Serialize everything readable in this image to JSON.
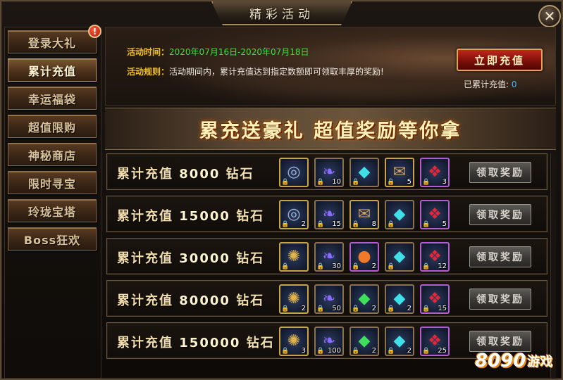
{
  "window": {
    "title": "精彩活动",
    "close_label": "✕"
  },
  "sidebar": {
    "alert": "!",
    "items": [
      {
        "label": "登录大礼",
        "active": false
      },
      {
        "label": "累计充值",
        "active": true
      },
      {
        "label": "幸运福袋",
        "active": false
      },
      {
        "label": "超值限购",
        "active": false
      },
      {
        "label": "神秘商店",
        "active": false
      },
      {
        "label": "限时寻宝",
        "active": false
      },
      {
        "label": "玲珑宝塔",
        "active": false
      },
      {
        "label": "Boss狂欢",
        "active": false
      }
    ]
  },
  "header": {
    "time_label": "活动时间：",
    "time_value": "2020年07月16日-2020年07月18日",
    "rule_label": "活动规则：",
    "rule_value": "活动期间内，累计充值达到指定数额即可领取丰厚的奖励!",
    "recharge_button": "立即充值",
    "accum_label": "已累计充值: ",
    "accum_value": "0"
  },
  "slogan": "累充送豪礼  超值奖励等你拿",
  "rows": [
    {
      "prefix": "累计充值",
      "amount": "8000",
      "unit": "钻石",
      "items": [
        {
          "icon": "compass-token-icon",
          "glyph": "◎",
          "count": "",
          "color": "#9fb6d8",
          "frame": "gold"
        },
        {
          "icon": "feather-icon",
          "glyph": "❧",
          "count": "10",
          "color": "#8a6cff",
          "frame": "normal"
        },
        {
          "icon": "cyan-crystal-icon",
          "glyph": "◆",
          "count": "",
          "color": "#3fe0e8",
          "frame": "normal"
        },
        {
          "icon": "scroll-bag-icon",
          "glyph": "✉",
          "count": "5",
          "color": "#d2a05a",
          "frame": "gold"
        },
        {
          "icon": "red-gem-icon",
          "glyph": "❖",
          "count": "3",
          "color": "#e0283a",
          "frame": "purple"
        }
      ],
      "claim": "领取奖励"
    },
    {
      "prefix": "累计充值",
      "amount": "15000",
      "unit": "钻石",
      "items": [
        {
          "icon": "compass-token-icon",
          "glyph": "◎",
          "count": "2",
          "color": "#9fb6d8",
          "frame": "gold"
        },
        {
          "icon": "feather-icon",
          "glyph": "❧",
          "count": "15",
          "color": "#8a6cff",
          "frame": "normal"
        },
        {
          "icon": "scroll-bag-icon",
          "glyph": "✉",
          "count": "8",
          "color": "#d2a05a",
          "frame": "gold"
        },
        {
          "icon": "cyan-crystal-icon",
          "glyph": "◆",
          "count": "",
          "color": "#3fe0e8",
          "frame": "normal"
        },
        {
          "icon": "red-gem-icon",
          "glyph": "❖",
          "count": "5",
          "color": "#e0283a",
          "frame": "purple"
        }
      ],
      "claim": "领取奖励"
    },
    {
      "prefix": "累计充值",
      "amount": "30000",
      "unit": "钻石",
      "items": [
        {
          "icon": "gold-coin-icon",
          "glyph": "✺",
          "count": "",
          "color": "#e0b24a",
          "frame": "gold"
        },
        {
          "icon": "feather-icon",
          "glyph": "❧",
          "count": "30",
          "color": "#8a6cff",
          "frame": "normal"
        },
        {
          "icon": "rainbow-orb-icon",
          "glyph": "●",
          "count": "2",
          "color": "#f07a2a",
          "frame": "purple"
        },
        {
          "icon": "cyan-crystal-icon",
          "glyph": "◆",
          "count": "",
          "color": "#3fe0e8",
          "frame": "normal"
        },
        {
          "icon": "red-gem-icon",
          "glyph": "❖",
          "count": "12",
          "color": "#e0283a",
          "frame": "purple"
        }
      ],
      "claim": "领取奖励"
    },
    {
      "prefix": "累计充值",
      "amount": "80000",
      "unit": "钻石",
      "items": [
        {
          "icon": "gold-coin-icon",
          "glyph": "✺",
          "count": "2",
          "color": "#e0b24a",
          "frame": "gold"
        },
        {
          "icon": "feather-icon",
          "glyph": "❧",
          "count": "50",
          "color": "#8a6cff",
          "frame": "normal"
        },
        {
          "icon": "green-crystal-icon",
          "glyph": "◆",
          "count": "2",
          "color": "#3ee05a",
          "frame": "normal"
        },
        {
          "icon": "cyan-crystal-icon",
          "glyph": "◆",
          "count": "2",
          "color": "#3fe0e8",
          "frame": "normal"
        },
        {
          "icon": "red-gem-icon",
          "glyph": "❖",
          "count": "15",
          "color": "#e0283a",
          "frame": "purple"
        }
      ],
      "claim": "领取奖励"
    },
    {
      "prefix": "累计充值",
      "amount": "150000",
      "unit": "钻石",
      "items": [
        {
          "icon": "gold-coin-icon",
          "glyph": "✺",
          "count": "3",
          "color": "#e0b24a",
          "frame": "gold"
        },
        {
          "icon": "feather-icon",
          "glyph": "❧",
          "count": "100",
          "color": "#8a6cff",
          "frame": "normal"
        },
        {
          "icon": "green-crystal-icon",
          "glyph": "◆",
          "count": "2",
          "color": "#3ee05a",
          "frame": "normal"
        },
        {
          "icon": "cyan-crystal-icon",
          "glyph": "◆",
          "count": "2",
          "color": "#3fe0e8",
          "frame": "normal"
        },
        {
          "icon": "red-gem-icon",
          "glyph": "❖",
          "count": "25",
          "color": "#e0283a",
          "frame": "purple"
        }
      ],
      "claim": "领取奖励"
    }
  ],
  "watermark": {
    "num": "8090",
    "text": "游戏"
  }
}
